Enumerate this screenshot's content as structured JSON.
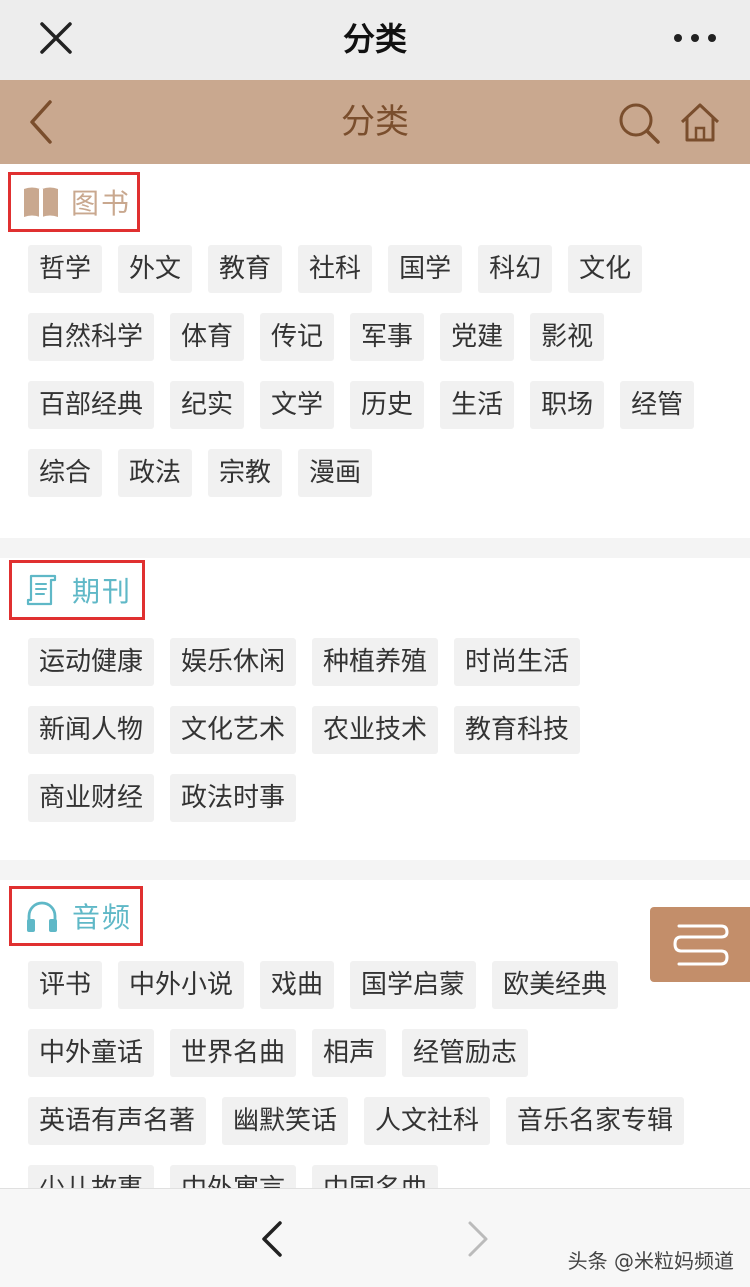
{
  "wechat_bar": {
    "title": "分类",
    "close_icon": "close-icon",
    "more_icon": "more-icon"
  },
  "header": {
    "title": "分类",
    "back_icon": "chevron-left-icon",
    "search_icon": "search-icon",
    "home_icon": "home-icon"
  },
  "colors": {
    "header_bg": "#c9a88f",
    "title": "#7a4e2d",
    "highlight_box": "#e03030",
    "book_accent": "#c9a88f",
    "teal_accent": "#5fb8c7",
    "tag_bg": "#f1f1f1",
    "float_btn": "#c38e6a"
  },
  "sections": {
    "books": {
      "title": "图书",
      "icon": "book-icon",
      "tags": [
        "哲学",
        "外文",
        "教育",
        "社科",
        "国学",
        "科幻",
        "文化",
        "自然科学",
        "体育",
        "传记",
        "军事",
        "党建",
        "影视",
        "百部经典",
        "纪实",
        "文学",
        "历史",
        "生活",
        "职场",
        "经管",
        "综合",
        "政法",
        "宗教",
        "漫画"
      ]
    },
    "journals": {
      "title": "期刊",
      "icon": "scroll-icon",
      "tags": [
        "运动健康",
        "娱乐休闲",
        "种植养殖",
        "时尚生活",
        "新闻人物",
        "文化艺术",
        "农业技术",
        "教育科技",
        "商业财经",
        "政法时事"
      ]
    },
    "audio": {
      "title": "音频",
      "icon": "headphones-icon",
      "tags": [
        "评书",
        "中外小说",
        "戏曲",
        "国学启蒙",
        "欧美经典",
        "中外童话",
        "世界名曲",
        "相声",
        "经管励志",
        "英语有声名著",
        "幽默笑话",
        "人文社科",
        "音乐名家专辑",
        "少儿故事",
        "中外寓言",
        "中国名曲"
      ]
    }
  },
  "floating_button": {
    "icon": "bookshelf-icon"
  },
  "bottom_nav": {
    "prev_icon": "chevron-left-icon",
    "next_icon": "chevron-right-icon",
    "watermark": "头条 @米粒妈频道"
  }
}
